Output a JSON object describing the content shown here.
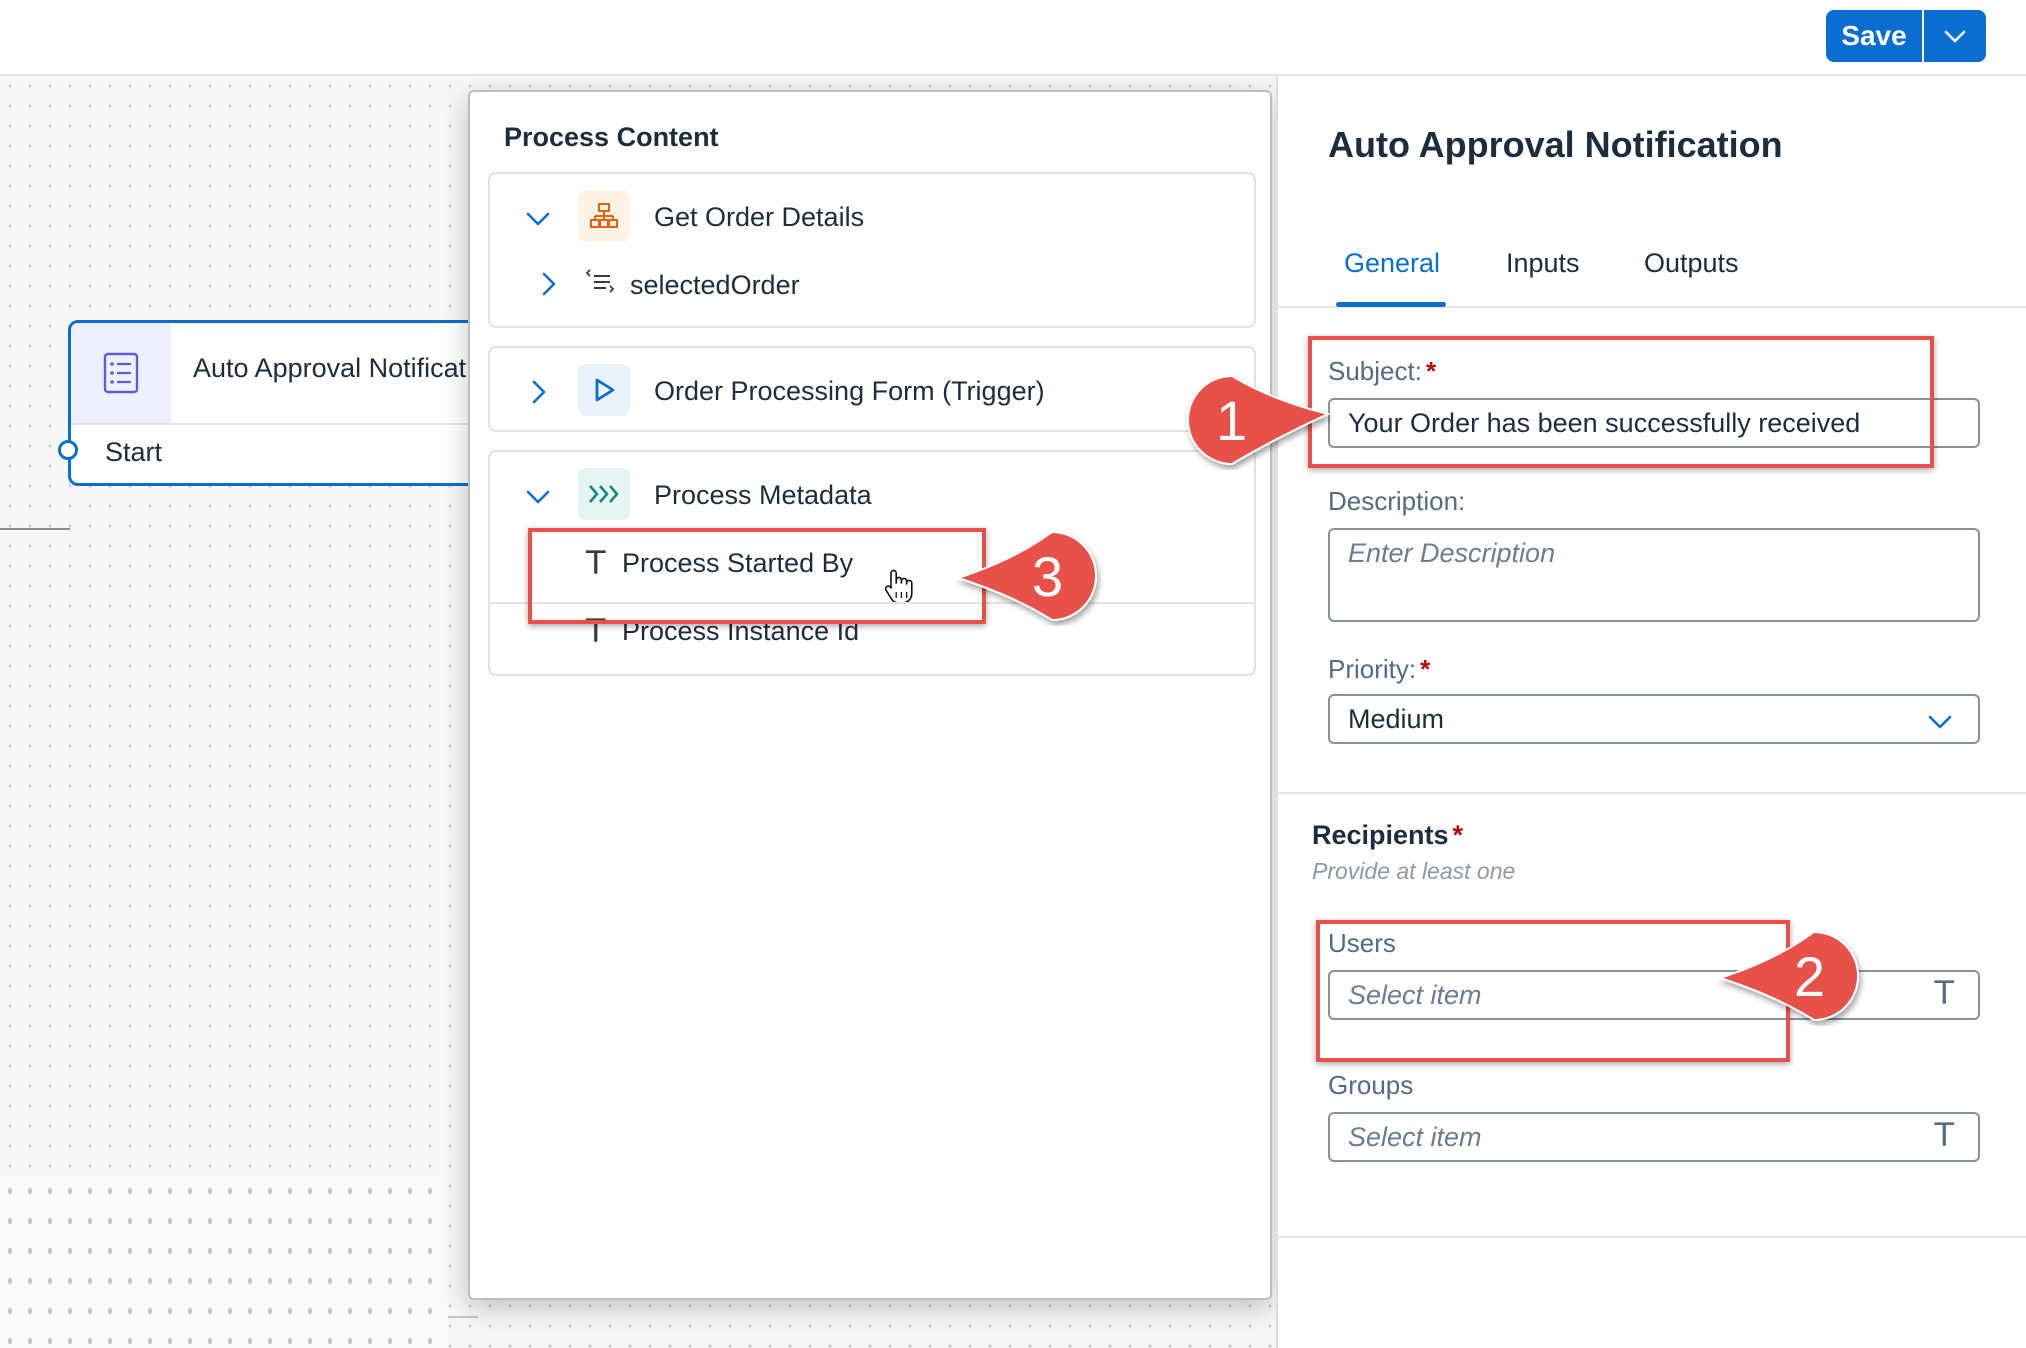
{
  "toolbar": {
    "save_label": "Save"
  },
  "canvas": {
    "node": {
      "title": "Auto Approval Notificat",
      "start_label": "Start"
    }
  },
  "process_content": {
    "title": "Process Content",
    "groups": [
      {
        "label": "Get Order Details",
        "expanded": true,
        "children": [
          {
            "label": "selectedOrder",
            "expanded": false
          }
        ]
      },
      {
        "label": "Order Processing Form (Trigger)",
        "expanded": false,
        "children": []
      },
      {
        "label": "Process Metadata",
        "expanded": true,
        "children": [
          {
            "label": "Process Started By"
          },
          {
            "label": "Process Instance Id"
          }
        ]
      }
    ],
    "text_type_glyph": "T"
  },
  "panel": {
    "title": "Auto Approval Notification",
    "tabs": [
      {
        "label": "General",
        "active": true
      },
      {
        "label": "Inputs",
        "active": false
      },
      {
        "label": "Outputs",
        "active": false
      }
    ],
    "subject": {
      "label": "Subject:",
      "required_mark": "*",
      "value": "Your Order has been successfully received"
    },
    "description": {
      "label": "Description:",
      "placeholder": "Enter Description"
    },
    "priority": {
      "label": "Priority:",
      "required_mark": "*",
      "value": "Medium"
    },
    "recipients": {
      "title": "Recipients",
      "required_mark": "*",
      "hint": "Provide at least one",
      "users": {
        "label": "Users",
        "placeholder": "Select item"
      },
      "groups": {
        "label": "Groups",
        "placeholder": "Select item"
      },
      "type_glyph": "T"
    }
  },
  "annotations": {
    "callouts": [
      "1",
      "2",
      "3"
    ]
  },
  "colors": {
    "accent": "#0a6ed1",
    "required": "#bb0000",
    "annotation": "#e8514a"
  }
}
